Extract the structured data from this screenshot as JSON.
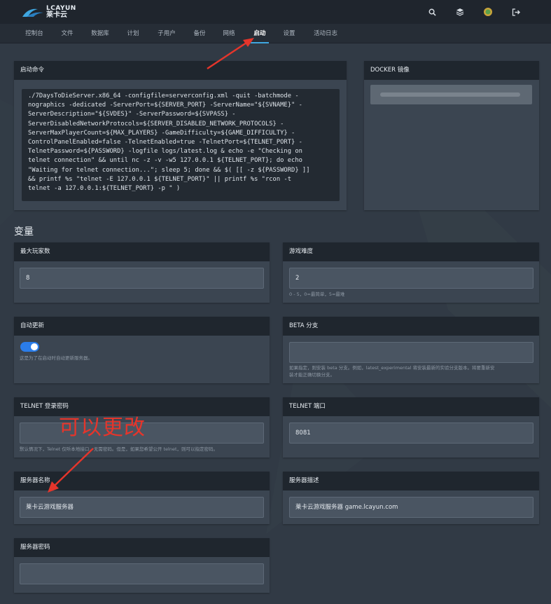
{
  "brand": {
    "top": "LCAYUN",
    "bottom": "莱卡云"
  },
  "top_icons": [
    "search-icon",
    "layers-icon",
    "avatar",
    "logout-icon"
  ],
  "nav": [
    "控制台",
    "文件",
    "数据库",
    "计划",
    "子用户",
    "备份",
    "网络",
    "启动",
    "设置",
    "活动日志"
  ],
  "startup": {
    "title": "启动命令",
    "command": "./7DaysToDieServer.x86_64 -configfile=serverconfig.xml -quit -batchmode -\nnographics -dedicated -ServerPort=${SERVER_PORT} -ServerName=\"${SVNAME}\" -\nServerDescription=\"${SVDES}\" -ServerPassword=${SVPASS} -\nServerDisabledNetworkProtocols=${SERVER_DISABLED_NETWORK_PROTOCOLS} -\nServerMaxPlayerCount=${MAX_PLAYERS} -GameDifficulty=${GAME_DIFFICULTY} -\nControlPanelEnabled=false -TelnetEnabled=true -TelnetPort=${TELNET_PORT} -\nTelnetPassword=${PASSWORD} -logfile logs/latest.log & echo -e \"Checking on\ntelnet connection\" && until nc -z -v -w5 127.0.0.1 ${TELNET_PORT}; do echo\n\"Waiting for telnet connection...\"; sleep 5; done && $( [[ -z ${PASSWORD} ]]\n&& printf %s \"telnet -E 127.0.0.1 ${TELNET_PORT}\" || printf %s \"rcon -t\ntelnet -a 127.0.0.1:${TELNET_PORT} -p \" )"
  },
  "docker": {
    "title": "DOCKER 镜像"
  },
  "variables_title": "变量",
  "vars": {
    "max_players": {
      "label": "最大玩家数",
      "value": "8"
    },
    "difficulty": {
      "label": "游戏难度",
      "value": "2",
      "help": "0 - 5，0=最简单，5=最难"
    },
    "auto_update": {
      "label": "自动更新",
      "enabled": true,
      "help": "这是为了在启动时自动更新服务器。"
    },
    "beta": {
      "label": "BETA 分支",
      "value": "",
      "help1": "如果指定，则安装 beta 分支。例如，latest_experimental 将安装最新的实验分支版本。将要重新安",
      "help2": "装才能正确切换分支。"
    },
    "telnet_pass": {
      "label": "TELNET 登录密码",
      "value": "",
      "help": "默认情况下，Telnet 仅听本地接口，无需密码。但是，如果您希望公开 telnet，则可以指定密码。"
    },
    "telnet_port": {
      "label": "TELNET 端口",
      "value": "8081"
    },
    "server_name": {
      "label": "服务器名称",
      "value": "莱卡云游戏服务器"
    },
    "server_desc": {
      "label": "服务器描述",
      "value": "莱卡云游戏服务器 game.lcayun.com"
    },
    "server_pass": {
      "label": "服务器密码",
      "value": ""
    }
  },
  "annotation": "可以更改",
  "colors": {
    "accent": "#3fa7e0",
    "annotation_red": "#e5352b",
    "toggle": "#2b7de9"
  }
}
